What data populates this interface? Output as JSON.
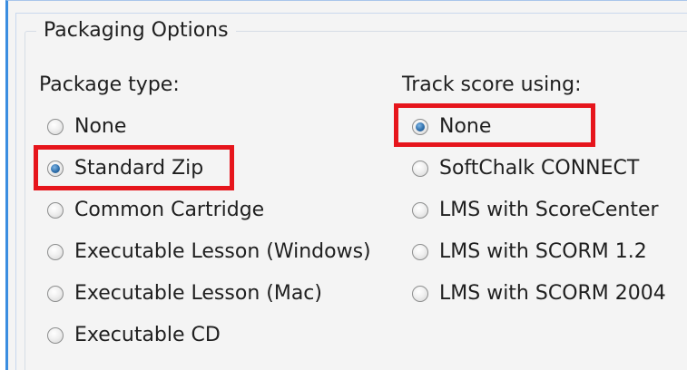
{
  "group": {
    "title": "Packaging Options"
  },
  "package_type": {
    "label": "Package type:",
    "options": [
      {
        "label": "None",
        "checked": false
      },
      {
        "label": "Standard Zip",
        "checked": true
      },
      {
        "label": "Common Cartridge",
        "checked": false
      },
      {
        "label": "Executable Lesson (Windows)",
        "checked": false
      },
      {
        "label": "Executable Lesson (Mac)",
        "checked": false
      },
      {
        "label": "Executable CD",
        "checked": false
      }
    ]
  },
  "track_score": {
    "label": "Track score using:",
    "options": [
      {
        "label": "None",
        "checked": true
      },
      {
        "label": "SoftChalk CONNECT",
        "checked": false
      },
      {
        "label": "LMS with ScoreCenter",
        "checked": false
      },
      {
        "label": "LMS with SCORM 1.2",
        "checked": false
      },
      {
        "label": "LMS with SCORM 2004",
        "checked": false
      }
    ]
  },
  "colors": {
    "highlight": "#e6151c",
    "accent": "#3a8de0",
    "radio_checked": "#2f6fab"
  }
}
